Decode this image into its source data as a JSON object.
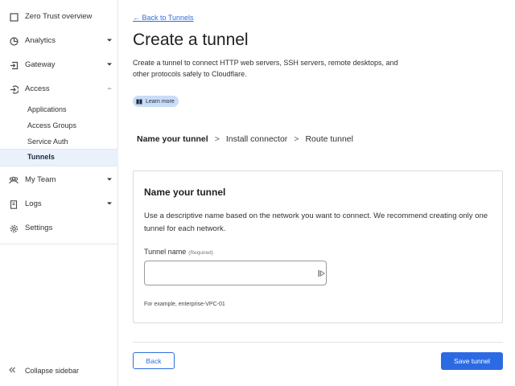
{
  "sidebar": {
    "items": [
      {
        "label": "Zero Trust overview",
        "icon": "home-icon"
      },
      {
        "label": "Analytics",
        "icon": "pie-chart-icon",
        "expandable": true
      },
      {
        "label": "Gateway",
        "icon": "gateway-icon",
        "expandable": true
      },
      {
        "label": "Access",
        "icon": "access-icon",
        "expandable": true,
        "expanded": true
      },
      {
        "label": "My Team",
        "icon": "team-icon",
        "expandable": true
      },
      {
        "label": "Logs",
        "icon": "logs-icon",
        "expandable": true
      },
      {
        "label": "Settings",
        "icon": "gear-icon"
      }
    ],
    "access_subitems": [
      {
        "label": "Applications"
      },
      {
        "label": "Access Groups"
      },
      {
        "label": "Service Auth"
      },
      {
        "label": "Tunnels",
        "active": true
      }
    ],
    "collapse_label": "Collapse sidebar"
  },
  "main": {
    "back_link": "← Back to Tunnels",
    "title": "Create a tunnel",
    "intro": "Create a tunnel to connect HTTP web servers, SSH servers, remote desktops, and other protocols safely to Cloudflare.",
    "learn_more": "Learn more",
    "steps": [
      {
        "label": "Name your tunnel",
        "active": true
      },
      {
        "label": "Install connector"
      },
      {
        "label": "Route tunnel"
      }
    ],
    "step_separator": ">",
    "card": {
      "title": "Name your tunnel",
      "description": "Use a descriptive name based on the network you want to connect. We recommend creating only one tunnel for each network.",
      "field_label": "Tunnel name",
      "field_required": "(Required)",
      "field_value": "",
      "field_placeholder": "",
      "field_hint": "For example, enterprise-VPC-01"
    },
    "buttons": {
      "back": "Back",
      "save": "Save tunnel"
    }
  },
  "colors": {
    "accent": "#2c6ae4",
    "link": "#2f6fdc",
    "active_nav_bg": "#eaf1fb",
    "badge_bg": "#c9dcf8"
  }
}
